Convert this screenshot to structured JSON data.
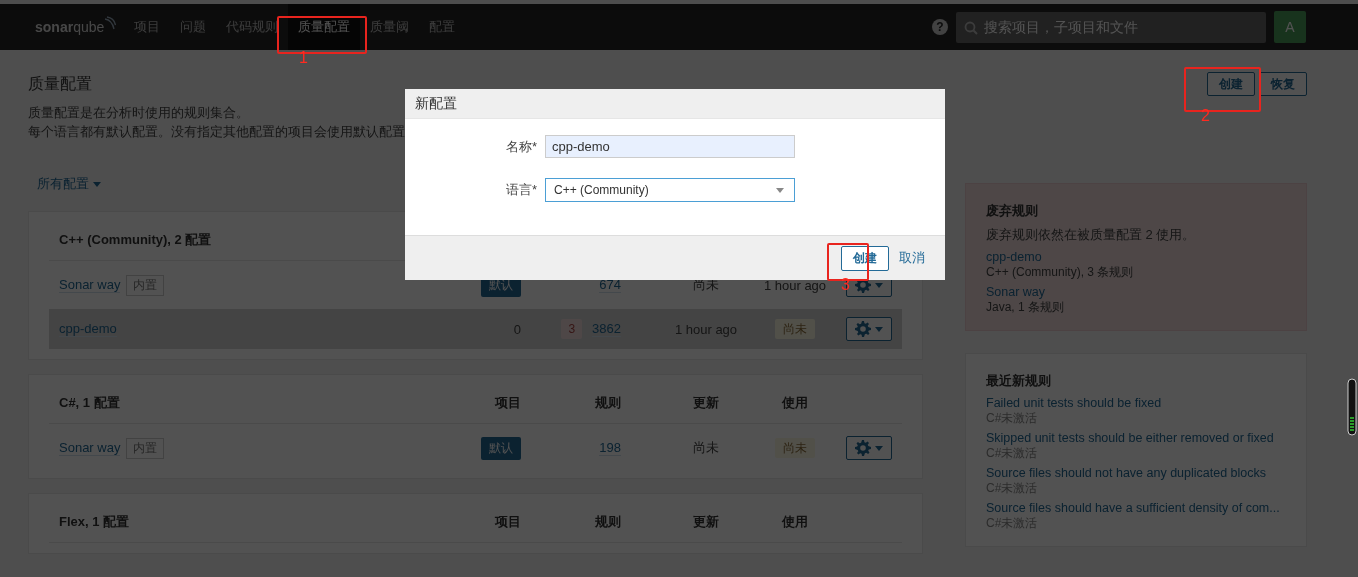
{
  "nav": {
    "logo": "**sonar**qube",
    "items": [
      {
        "label": "项目",
        "selected": false
      },
      {
        "label": "问题",
        "selected": false
      },
      {
        "label": "代码规则",
        "selected": false
      },
      {
        "label": "质量配置",
        "selected": true
      },
      {
        "label": "质量阈",
        "selected": false
      },
      {
        "label": "配置",
        "selected": false
      }
    ],
    "help": "?",
    "search": {
      "placeholder": "搜索项目，子项目和文件"
    },
    "avatar": "A"
  },
  "page": {
    "title": "质量配置",
    "description": [
      "质量配置是在分析时使用的规则集合。",
      "每个语言都有默认配置。没有指定其他配置的项目会使用默认配置"
    ],
    "buttons": [
      "创建",
      "恢复"
    ],
    "filter": "所有配置"
  },
  "languages": [
    {
      "title": "C++ (Community), 2 配置",
      "profiles": [
        {
          "name": "Sonar way",
          "tag": "内置",
          "highlighted": false,
          "projects": {
            "kind": "badge",
            "text": "默认"
          },
          "rules": "674",
          "updated": "尚未",
          "used": {
            "kind": "text",
            "text": "1 hour ago"
          }
        },
        {
          "name": "cpp-demo",
          "highlighted": true,
          "projects": {
            "kind": "text",
            "text": "0"
          },
          "issues": "3",
          "rules": "3862",
          "updated": "1 hour ago",
          "used": {
            "kind": "badge",
            "text": "尚未"
          }
        }
      ]
    },
    {
      "title": "C#, 1 配置",
      "columns": [
        "项目",
        "规则",
        "更新",
        "使用"
      ],
      "profiles": [
        {
          "name": "Sonar way",
          "tag": "内置",
          "highlighted": false,
          "projects": {
            "kind": "badge",
            "text": "默认"
          },
          "rules": "198",
          "updated": "尚未",
          "used": {
            "kind": "badge",
            "text": "尚未"
          }
        }
      ]
    },
    {
      "title": "Flex, 1 配置",
      "columns": [
        "项目",
        "规则",
        "更新",
        "使用"
      ]
    }
  ],
  "deprecated": {
    "title": "废弃规则",
    "text": "废弃规则依然在被质量配置 2 使用。",
    "items": [
      {
        "name": "cpp-demo",
        "meta": "C++ (Community), 3 条规则"
      },
      {
        "name": "Sonar way",
        "meta": "Java, 1 条规则"
      }
    ]
  },
  "recent": {
    "title": "最近新规则",
    "items": [
      {
        "name": "Failed unit tests should be fixed",
        "meta": "C#未激活"
      },
      {
        "name": "Skipped unit tests should be either removed or fixed",
        "meta": "C#未激活"
      },
      {
        "name": "Source files should not have any duplicated blocks",
        "meta": "C#未激活"
      },
      {
        "name": "Source files should have a sufficient density of com...",
        "meta": "C#未激活"
      }
    ]
  },
  "modal": {
    "title": "新配置",
    "fields": [
      {
        "label": "名称",
        "mark": "*",
        "kind": "text",
        "value": "cpp-demo"
      },
      {
        "label": "语言",
        "mark": "*",
        "kind": "select",
        "value": "C++ (Community)"
      }
    ],
    "submit": "创建",
    "cancel": "取消"
  },
  "annotations": [
    {
      "label": "1"
    },
    {
      "label": "2"
    },
    {
      "label": "3"
    }
  ]
}
